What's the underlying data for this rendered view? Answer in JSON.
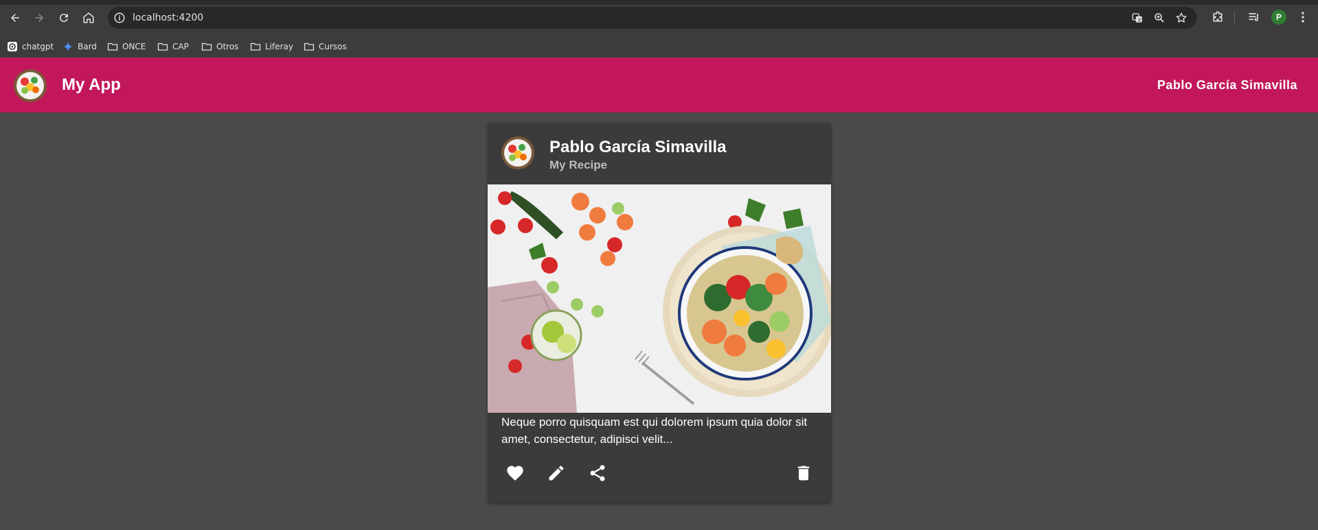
{
  "browser": {
    "url": "localhost:4200",
    "profile_initial": "P",
    "bookmarks": [
      {
        "label": "chatgpt",
        "icon": "chatgpt-icon"
      },
      {
        "label": "Bard",
        "icon": "bard-icon"
      },
      {
        "label": "ONCE",
        "icon": "folder-icon"
      },
      {
        "label": "CAP",
        "icon": "folder-icon"
      },
      {
        "label": "Otros",
        "icon": "folder-icon"
      },
      {
        "label": "Liferay",
        "icon": "folder-icon"
      },
      {
        "label": "Cursos",
        "icon": "folder-icon"
      }
    ]
  },
  "toolbar": {
    "title": "My App",
    "user": "Pablo García Simavilla",
    "color": "#c2185b"
  },
  "card": {
    "title": "Pablo García Simavilla",
    "subtitle": "My Recipe",
    "text": "Neque porro quisquam est qui dolorem ipsum quia dolor sit amet, consectetur, adipisci velit...",
    "actions": [
      {
        "icon": "heart-icon"
      },
      {
        "icon": "edit-icon"
      },
      {
        "icon": "share-icon"
      },
      {
        "icon": "delete-icon"
      }
    ]
  }
}
